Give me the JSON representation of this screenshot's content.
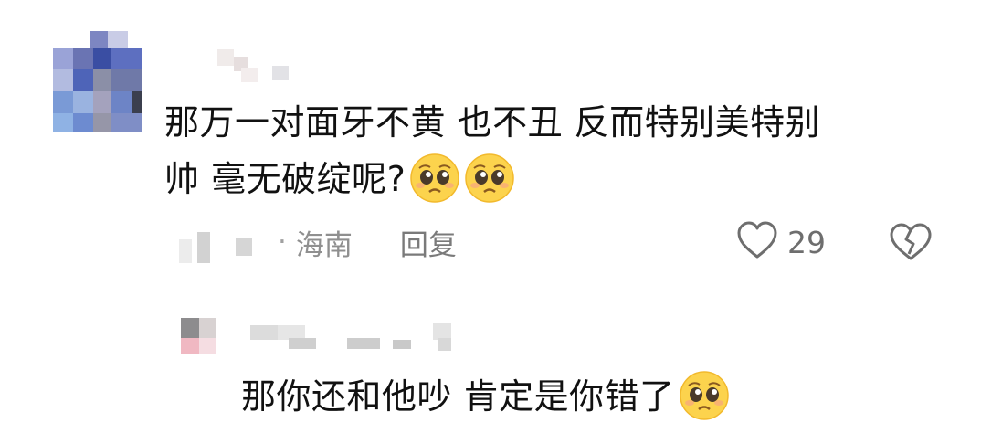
{
  "comment": {
    "line1": "那万一对面牙不黄 也不丑 反而特别美特别",
    "line2": "帅 毫无破绽呢?",
    "emojis": [
      "pleading-face-emoji",
      "pleading-face-emoji"
    ],
    "location_separator": "·",
    "location": "海南",
    "reply_label": "回复",
    "like_count": "29",
    "like_icon": "heart-outline-icon",
    "dislike_icon": "broken-heart-outline-icon"
  },
  "reply": {
    "text": "那你还和他吵 肯定是你错了",
    "emoji": "pleading-face-emoji"
  },
  "colors": {
    "text": "#111111",
    "meta": "#8a8a8a",
    "icon": "#6e6e6e",
    "emoji_face": "#fcd34d"
  }
}
